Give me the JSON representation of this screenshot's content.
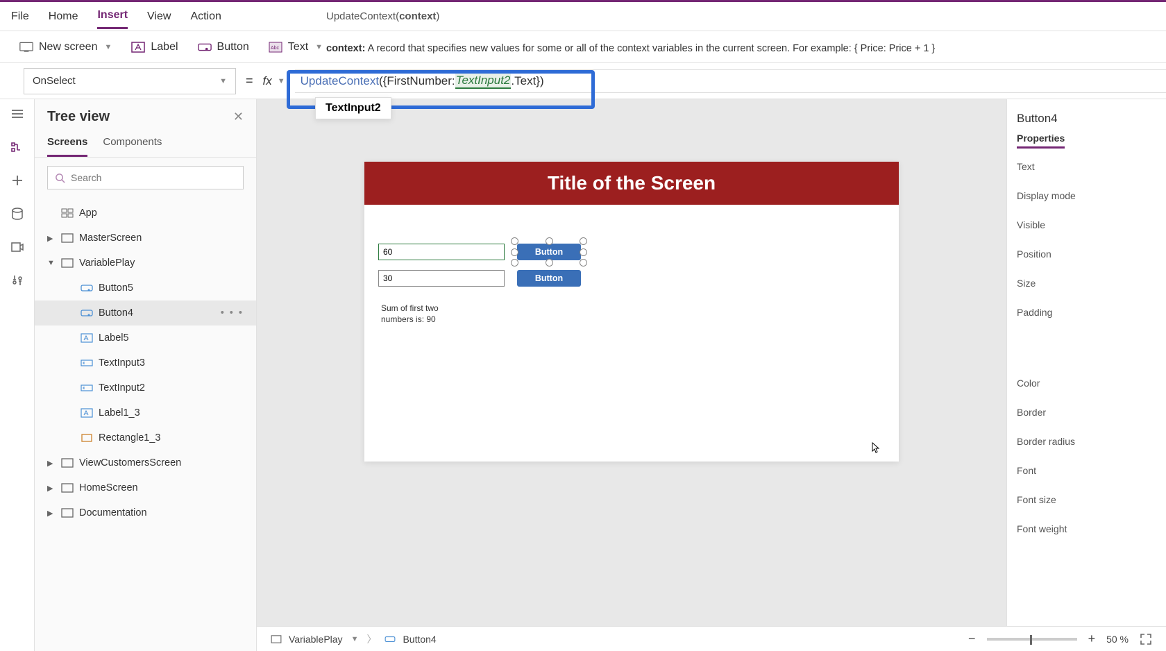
{
  "menubar": {
    "items": [
      "File",
      "Home",
      "Insert",
      "View",
      "Action"
    ],
    "active": "Insert",
    "function_hint_name": "UpdateContext(",
    "function_hint_bold": "context",
    "function_hint_close": ")"
  },
  "ribbon": {
    "new_screen": "New screen",
    "label": "Label",
    "button": "Button",
    "text": "Text"
  },
  "context_help": {
    "label": "context:",
    "text": " A record that specifies new values for some or all of the context variables in the current screen. For example: { Price: Price + 1 }"
  },
  "formula": {
    "property": "OnSelect",
    "fn": "UpdateContext",
    "open": "({FirstNumber: ",
    "ref": "TextInput2",
    "after": ".Text})"
  },
  "intellisense": "TextInput2",
  "tree": {
    "title": "Tree view",
    "tabs": [
      "Screens",
      "Components"
    ],
    "search_placeholder": "Search",
    "app": "App",
    "screens": [
      {
        "name": "MasterScreen",
        "expanded": false
      },
      {
        "name": "VariablePlay",
        "expanded": true,
        "children": [
          {
            "name": "Button5",
            "type": "button"
          },
          {
            "name": "Button4",
            "type": "button",
            "selected": true
          },
          {
            "name": "Label5",
            "type": "label"
          },
          {
            "name": "TextInput3",
            "type": "input"
          },
          {
            "name": "TextInput2",
            "type": "input"
          },
          {
            "name": "Label1_3",
            "type": "label"
          },
          {
            "name": "Rectangle1_3",
            "type": "rect"
          }
        ]
      },
      {
        "name": "ViewCustomersScreen",
        "expanded": false
      },
      {
        "name": "HomeScreen",
        "expanded": false
      },
      {
        "name": "Documentation",
        "expanded": false
      }
    ]
  },
  "canvas": {
    "title": "Title of the Screen",
    "input1": "60",
    "input2": "30",
    "button1": "Button",
    "button2": "Button",
    "sum_label": "Sum of first two numbers is: 90"
  },
  "props": {
    "control": "Button4",
    "tab": "Properties",
    "rows": [
      "Text",
      "Display mode",
      "Visible",
      "Position",
      "Size",
      "Padding",
      "Color",
      "Border",
      "Border radius",
      "Font",
      "Font size",
      "Font weight"
    ]
  },
  "statusbar": {
    "screen": "VariablePlay",
    "control": "Button4",
    "zoom": "50",
    "zoom_unit": "%"
  }
}
